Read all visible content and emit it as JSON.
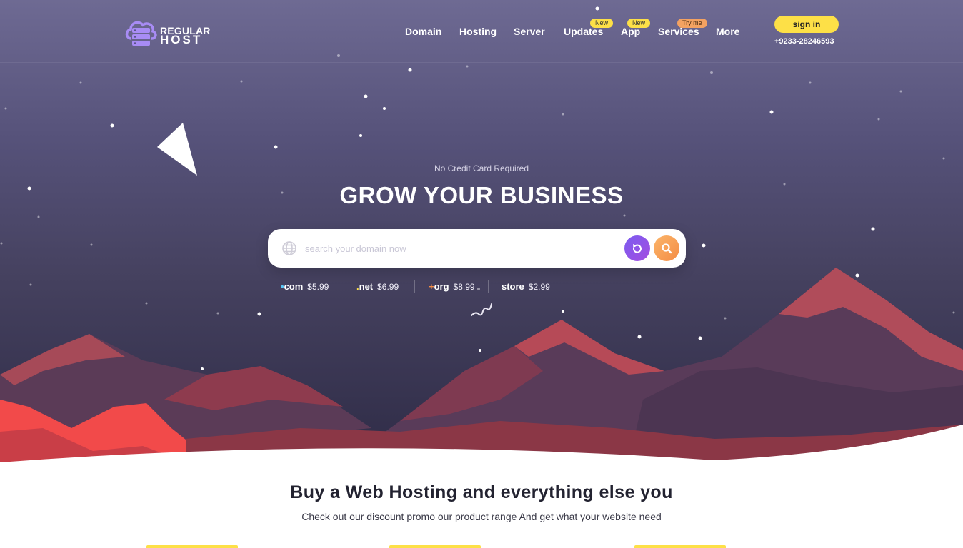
{
  "brand": {
    "logo_top": "REGULAR",
    "logo_bottom": "HOST"
  },
  "nav": {
    "items": [
      {
        "label": "Domain",
        "badge": ""
      },
      {
        "label": "Hosting",
        "badge": ""
      },
      {
        "label": "Server",
        "badge": ""
      },
      {
        "label": "Updates",
        "badge": "New"
      },
      {
        "label": "App",
        "badge": "New"
      },
      {
        "label": "Services",
        "badge": "Try me"
      },
      {
        "label": "More",
        "badge": ""
      }
    ]
  },
  "account": {
    "signin_label": "sign in",
    "phone": "+9233-28246593"
  },
  "hero": {
    "eyebrow": "No Credit Card Required",
    "headline": "GROW YOUR BUSINESS",
    "search_placeholder": "search your domain now"
  },
  "tlds": [
    {
      "prefix": "•",
      "name": "com",
      "price": "$5.99",
      "dot_color": "#5bc8f5"
    },
    {
      "prefix": ".",
      "name": "net",
      "price": "$6.99",
      "dot_color": "#fde047"
    },
    {
      "prefix": "+",
      "name": "org",
      "price": "$8.99",
      "dot_color": "#f48c44"
    },
    {
      "prefix": "",
      "name": "store",
      "price": "$2.99",
      "dot_color": "#ffffff"
    }
  ],
  "section": {
    "title": "Buy a Web Hosting and everything else you",
    "subtitle": "Check out our discount promo our product range And get what your website need"
  },
  "colors": {
    "accent_yellow": "#fde047",
    "accent_purple": "#7c5cf0",
    "accent_orange": "#f48c44",
    "mountain_red": "#8e3b4e",
    "mountain_coral": "#f24a4a"
  }
}
